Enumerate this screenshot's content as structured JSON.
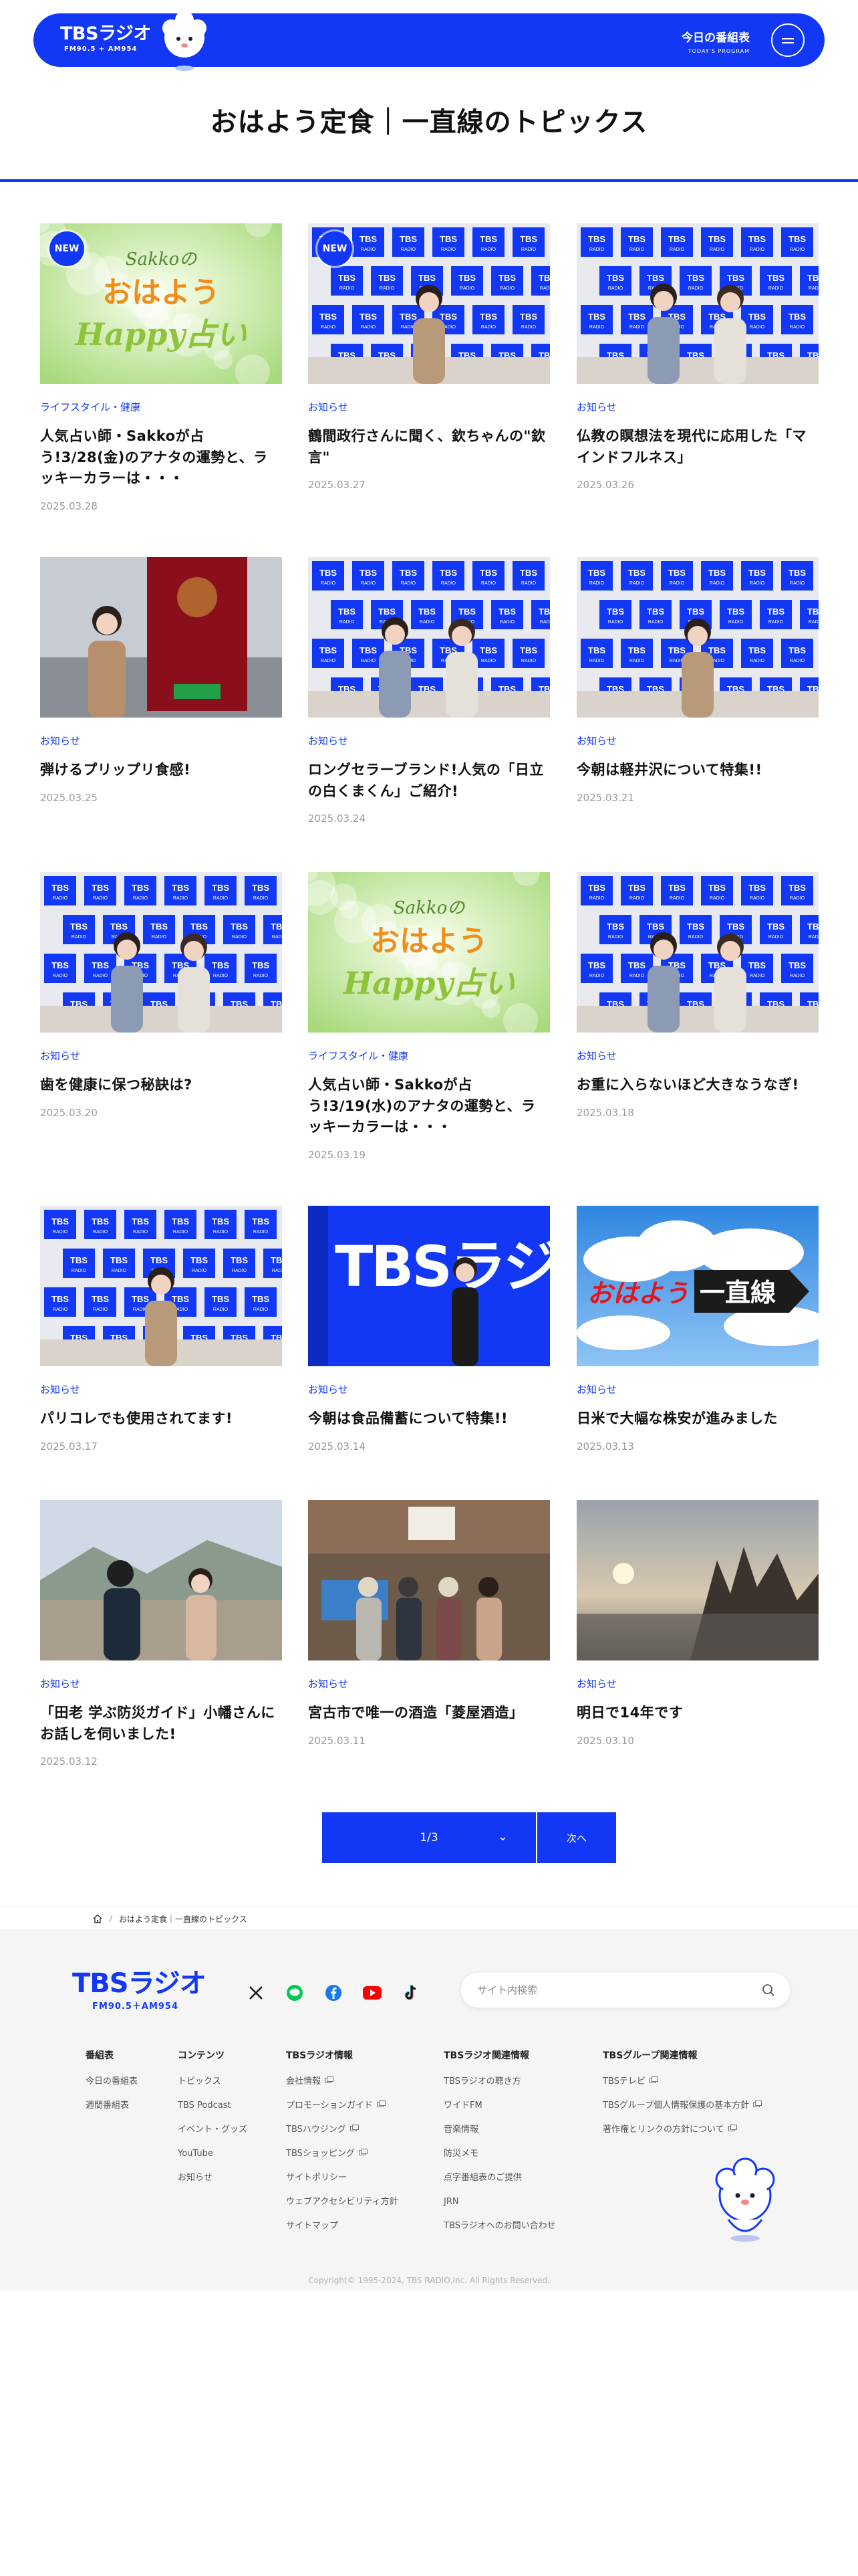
{
  "header": {
    "logo_main": "TBSラジオ",
    "logo_sub": "FM90.5 + AM954",
    "program_label": "今日の番組表",
    "program_label_en": "TODAY'S PROGRAM"
  },
  "page_title": "おはよう定食｜一直線のトピックス",
  "new_badge": "NEW",
  "articles": [
    {
      "category": "ライフスタイル・健康",
      "title": "人気占い師・Sakkoが占う!3/28(金)のアナタの運勢と、ラッキーカラーは・・・",
      "date": "2025.03.28",
      "image": "horoscope-banner",
      "new": true,
      "banner_brand": "Sakkoの",
      "banner_main": "おはよう",
      "banner_sub": "Happy占い"
    },
    {
      "category": "お知らせ",
      "title": "鶴間政行さんに聞く、欽ちゃんの\"欽言\"",
      "date": "2025.03.27",
      "image": "studio-photo",
      "new": true
    },
    {
      "category": "お知らせ",
      "title": "仏教の瞑想法を現代に応用した「マインドフルネス」",
      "date": "2025.03.26",
      "image": "studio-photo",
      "new": false
    },
    {
      "category": "お知らせ",
      "title": "弾けるプリップリ食感!",
      "date": "2025.03.25",
      "image": "poster-photo",
      "new": false
    },
    {
      "category": "お知らせ",
      "title": "ロングセラーブランド!人気の「日立の白くまくん」ご紹介!",
      "date": "2025.03.24",
      "image": "studio-photo",
      "new": false
    },
    {
      "category": "お知らせ",
      "title": "今朝は軽井沢について特集!!",
      "date": "2025.03.21",
      "image": "studio-photo",
      "new": false
    },
    {
      "category": "お知らせ",
      "title": "歯を健康に保つ秘訣は?",
      "date": "2025.03.20",
      "image": "studio-photo",
      "new": false
    },
    {
      "category": "ライフスタイル・健康",
      "title": "人気占い師・Sakkoが占う!3/19(水)のアナタの運勢と、ラッキーカラーは・・・",
      "date": "2025.03.19",
      "image": "horoscope-banner",
      "new": false,
      "banner_brand": "Sakkoの",
      "banner_main": "おはよう",
      "banner_sub": "Happy占い"
    },
    {
      "category": "お知らせ",
      "title": "お重に入らないほど大きなうなぎ!",
      "date": "2025.03.18",
      "image": "studio-photo",
      "new": false
    },
    {
      "category": "お知らせ",
      "title": "パリコレでも使用されてます!",
      "date": "2025.03.17",
      "image": "studio-photo",
      "new": false
    },
    {
      "category": "お知らせ",
      "title": "今朝は食品備蓄について特集!!",
      "date": "2025.03.14",
      "image": "tbs-wall-photo",
      "new": false,
      "wall_text": "TBSラジオ"
    },
    {
      "category": "お知らせ",
      "title": "日米で大幅な株安が進みました",
      "date": "2025.03.13",
      "image": "program-logo-sky",
      "new": false,
      "logo_text_a": "おはよう",
      "logo_text_b": "一直線"
    },
    {
      "category": "お知らせ",
      "title": "「田老 学ぶ防災ガイド」小幡さんにお話しを伺いました!",
      "date": "2025.03.12",
      "image": "outdoor-photo",
      "new": false
    },
    {
      "category": "お知らせ",
      "title": "宮古市で唯一の酒造「菱屋酒造」",
      "date": "2025.03.11",
      "image": "outdoor-photo",
      "new": false
    },
    {
      "category": "お知らせ",
      "title": "明日で14年です",
      "date": "2025.03.10",
      "image": "sunset-photo",
      "new": false
    }
  ],
  "pager": {
    "current": "1/3",
    "next_label": "次へ"
  },
  "breadcrumb": {
    "home_icon": "home-icon",
    "current": "おはよう定食｜一直線のトピックス"
  },
  "footer": {
    "logo_main": "TBSラジオ",
    "logo_sub": "FM90.5＋AM954",
    "social_icons": [
      "x-icon",
      "line-icon",
      "facebook-icon",
      "youtube-icon",
      "tiktok-icon"
    ],
    "search_placeholder": "サイト内検索",
    "columns": [
      {
        "heading": "番組表",
        "links": [
          {
            "label": "今日の番組表",
            "ext": false
          },
          {
            "label": "週間番組表",
            "ext": false
          }
        ]
      },
      {
        "heading": "コンテンツ",
        "links": [
          {
            "label": "トピックス",
            "ext": false
          },
          {
            "label": "TBS Podcast",
            "ext": false
          },
          {
            "label": "イベント・グッズ",
            "ext": false
          },
          {
            "label": "YouTube",
            "ext": false
          },
          {
            "label": "お知らせ",
            "ext": false
          }
        ]
      },
      {
        "heading": "TBSラジオ情報",
        "links": [
          {
            "label": "会社情報",
            "ext": true
          },
          {
            "label": "プロモーションガイド",
            "ext": true
          },
          {
            "label": "TBSハウジング",
            "ext": true
          },
          {
            "label": "TBSショッピング",
            "ext": true
          },
          {
            "label": "サイトポリシー",
            "ext": false
          },
          {
            "label": "ウェブアクセシビリティ方針",
            "ext": false
          },
          {
            "label": "サイトマップ",
            "ext": false
          }
        ]
      },
      {
        "heading": "TBSラジオ関連情報",
        "links": [
          {
            "label": "TBSラジオの聴き方",
            "ext": false
          },
          {
            "label": "ワイドFM",
            "ext": false
          },
          {
            "label": "音楽情報",
            "ext": false
          },
          {
            "label": "防災メモ",
            "ext": false
          },
          {
            "label": "点字番組表のご提供",
            "ext": false
          },
          {
            "label": "JRN",
            "ext": false
          },
          {
            "label": "TBSラジオへのお問い合わせ",
            "ext": false
          }
        ]
      },
      {
        "heading": "TBSグループ関連情報",
        "links": [
          {
            "label": "TBSテレビ",
            "ext": true
          },
          {
            "label": "TBSグループ個人情報保護の基本方針",
            "ext": true
          },
          {
            "label": "著作権とリンクの方針について",
            "ext": true
          }
        ]
      }
    ],
    "copyright": "Copyright© 1995-2024, TBS RADIO,Inc. All Rights Reserved."
  },
  "colors": {
    "brand_blue": "#1238f5",
    "footer_bg": "#f5f5f5",
    "date_gray": "#9a9a9a"
  }
}
